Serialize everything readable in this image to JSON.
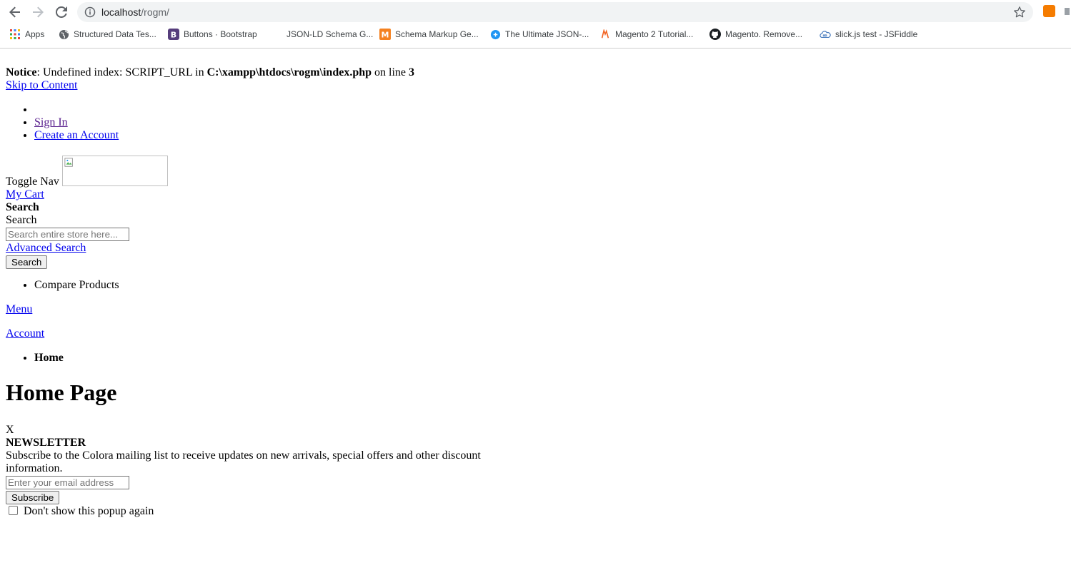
{
  "browser": {
    "url_host": "localhost",
    "url_path": "/rogm/",
    "bookmarks": [
      {
        "label": "Apps",
        "icon": "apps-grid-icon"
      },
      {
        "label": "Structured Data Tes...",
        "icon": "globe-icon"
      },
      {
        "label": "Buttons · Bootstrap",
        "icon": "bootstrap-icon"
      },
      {
        "label": "JSON-LD Schema G...",
        "icon": "blank-icon"
      },
      {
        "label": "Schema Markup Ge...",
        "icon": "m-logo-icon"
      },
      {
        "label": "The Ultimate JSON-...",
        "icon": "blue-circle-icon"
      },
      {
        "label": "Magento 2 Tutorial...",
        "icon": "magento-icon"
      },
      {
        "label": "Magento. Remove...",
        "icon": "github-icon"
      },
      {
        "label": "slick.js test - JSFiddle",
        "icon": "jsfiddle-cloud-icon"
      }
    ]
  },
  "notice": {
    "label": "Notice",
    "text1": ": Undefined index: SCRIPT_URL in ",
    "path": "C:\\xampp\\htdocs\\rogm\\index.php",
    "text2": " on line ",
    "line": "3"
  },
  "skip_link": "Skip to Content",
  "header_links": {
    "sign_in": "Sign In",
    "create_account": "Create an Account"
  },
  "toggle_nav": "Toggle Nav",
  "my_cart": "My Cart",
  "search": {
    "title": "Search",
    "label": "Search",
    "placeholder": "Search entire store here...",
    "advanced": "Advanced Search",
    "button": "Search"
  },
  "compare_products": "Compare Products",
  "menu_link": "Menu",
  "account_link": "Account",
  "breadcrumb_home": "Home",
  "page_title": "Home Page",
  "newsletter": {
    "close": "X",
    "title": "NEWSLETTER",
    "text": "Subscribe to the Colora mailing list to receive updates on new arrivals, special offers and other discount information.",
    "email_placeholder": "Enter your email address",
    "subscribe": "Subscribe",
    "dont_show": "Don't show this popup again"
  }
}
